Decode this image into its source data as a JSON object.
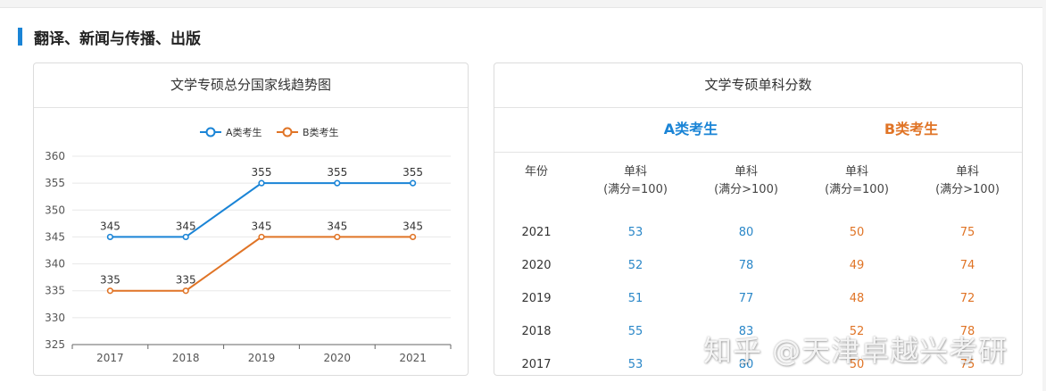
{
  "section": {
    "title": "翻译、新闻与传播、出版"
  },
  "chart_card": {
    "title": "文学专硕总分国家线趋势图"
  },
  "chart_data": {
    "type": "line",
    "categories": [
      "2017",
      "2018",
      "2019",
      "2020",
      "2021"
    ],
    "series": [
      {
        "name": "A类考生",
        "values": [
          345,
          345,
          355,
          355,
          355
        ],
        "color": "#1a84d6"
      },
      {
        "name": "B类考生",
        "values": [
          335,
          335,
          345,
          345,
          345
        ],
        "color": "#e07426"
      }
    ],
    "ylim": [
      325,
      360
    ],
    "yticks": [
      325,
      330,
      335,
      340,
      345,
      350,
      355,
      360
    ],
    "grid": true,
    "legend": "top-center",
    "data_labels": true
  },
  "table_card": {
    "title": "文学专硕单科分数",
    "categories": [
      {
        "label": "A类考生",
        "color": "#1a84d6"
      },
      {
        "label": "B类考生",
        "color": "#e07426"
      }
    ],
    "year_header": "年份",
    "col_headers": [
      {
        "line1": "单科",
        "line2": "(满分=100)"
      },
      {
        "line1": "单科",
        "line2": "(满分>100)"
      },
      {
        "line1": "单科",
        "line2": "(满分=100)"
      },
      {
        "line1": "单科",
        "line2": "(满分>100)"
      }
    ],
    "rows": [
      {
        "year": "2021",
        "values": [
          "53",
          "80",
          "50",
          "75"
        ]
      },
      {
        "year": "2020",
        "values": [
          "52",
          "78",
          "49",
          "74"
        ]
      },
      {
        "year": "2019",
        "values": [
          "51",
          "77",
          "48",
          "72"
        ]
      },
      {
        "year": "2018",
        "values": [
          "55",
          "83",
          "52",
          "78"
        ]
      },
      {
        "year": "2017",
        "values": [
          "53",
          "80",
          "50",
          "75"
        ]
      }
    ]
  },
  "watermark": {
    "text": "知乎 @天津卓越兴考研"
  }
}
